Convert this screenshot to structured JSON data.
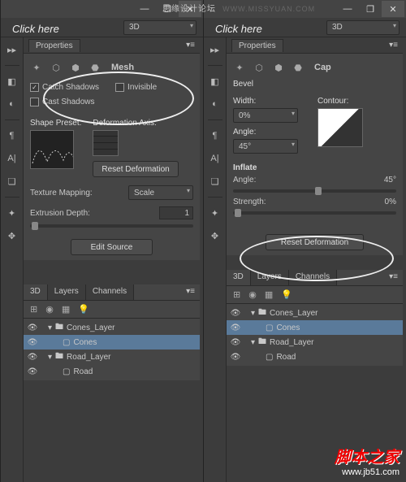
{
  "top_text": "思缘设计论坛",
  "watermark_url": "WWW.MISSYUAN.COM",
  "bottom": {
    "cn": "脚本之家",
    "url": "www.jb51.com"
  },
  "click_here": "Click here",
  "window": {
    "min": "—",
    "restore": "❐",
    "close": "✕"
  },
  "dropdown_3d": "3D",
  "properties_title": "Properties",
  "left": {
    "mode_label": "Mesh",
    "catch_shadows": "Catch Shadows",
    "cast_shadows": "Cast Shadows",
    "invisible": "Invisible",
    "shape_preset": "Shape Preset:",
    "deform_axis": "Deformation Axis:",
    "reset_deformation": "Reset Deformation",
    "texture_mapping": "Texture Mapping:",
    "texture_value": "Scale",
    "extrusion_depth": "Extrusion Depth:",
    "extrusion_value": "1",
    "edit_source": "Edit Source"
  },
  "right": {
    "mode_label": "Cap",
    "bevel": "Bevel",
    "width": "Width:",
    "width_value": "0%",
    "contour": "Contour:",
    "angle": "Angle:",
    "angle_value": "45°",
    "inflate": "Inflate",
    "inflate_angle": "Angle:",
    "inflate_angle_value": "45°",
    "strength": "Strength:",
    "strength_value": "0%",
    "reset_deformation": "Reset Deformation"
  },
  "layers": {
    "tabs": [
      "3D",
      "Layers",
      "Channels"
    ],
    "items": [
      {
        "name": "Cones_Layer",
        "type": "folder",
        "indent": 0
      },
      {
        "name": "Cones",
        "type": "item",
        "indent": 1,
        "selected": true
      },
      {
        "name": "Road_Layer",
        "type": "folder",
        "indent": 0
      },
      {
        "name": "Road",
        "type": "item",
        "indent": 1
      }
    ]
  }
}
